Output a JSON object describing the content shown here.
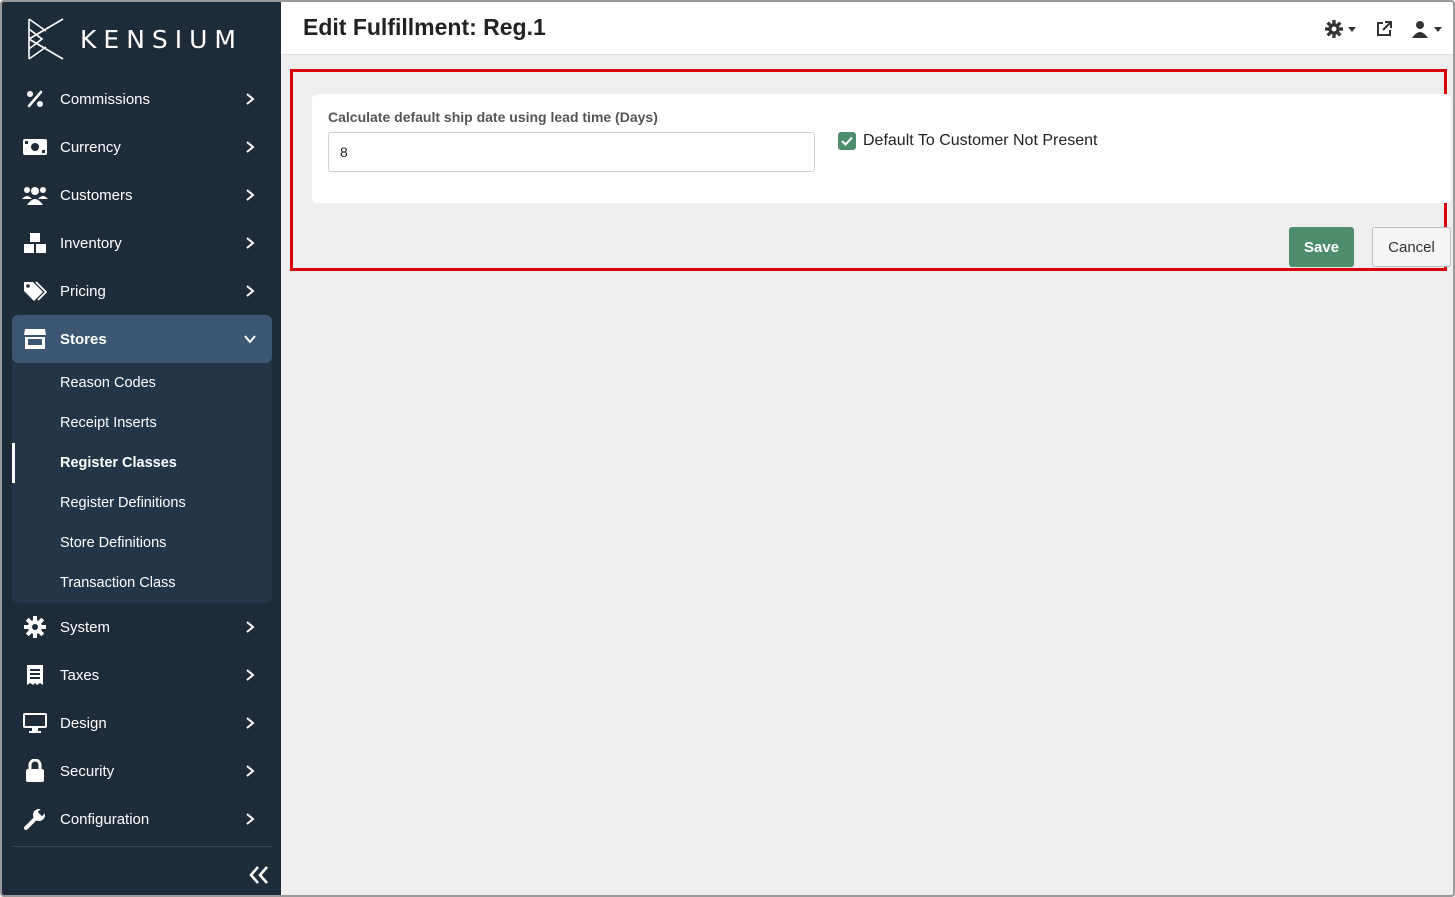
{
  "brand": {
    "name": "KENSIUM"
  },
  "colors": {
    "sidebar_bg": "#1e2b39",
    "active_nav": "#3c5673",
    "primary": "#4e8d6b",
    "highlight": "#d6000c"
  },
  "sidebar": {
    "items": [
      {
        "label": "Commissions",
        "icon": "percent-icon"
      },
      {
        "label": "Currency",
        "icon": "money-icon"
      },
      {
        "label": "Customers",
        "icon": "users-icon"
      },
      {
        "label": "Inventory",
        "icon": "boxes-icon"
      },
      {
        "label": "Pricing",
        "icon": "tags-icon"
      },
      {
        "label": "Stores",
        "icon": "store-icon"
      },
      {
        "label": "System",
        "icon": "gear-icon"
      },
      {
        "label": "Taxes",
        "icon": "receipt-icon"
      },
      {
        "label": "Design",
        "icon": "monitor-icon"
      },
      {
        "label": "Security",
        "icon": "lock-icon"
      },
      {
        "label": "Configuration",
        "icon": "wrench-icon"
      }
    ],
    "stores_submenu": [
      {
        "label": "Reason Codes"
      },
      {
        "label": "Receipt Inserts"
      },
      {
        "label": "Register Classes"
      },
      {
        "label": "Register Definitions"
      },
      {
        "label": "Store Definitions"
      },
      {
        "label": "Transaction Class"
      }
    ],
    "active_submenu": "Register Classes"
  },
  "header": {
    "title": "Edit Fulfillment: Reg.1"
  },
  "form": {
    "lead_time_label": "Calculate default ship date using lead time (Days)",
    "lead_time_value": "8",
    "customer_not_present_label": "Default To Customer Not Present",
    "customer_not_present_checked": true
  },
  "actions": {
    "save_label": "Save",
    "cancel_label": "Cancel"
  }
}
